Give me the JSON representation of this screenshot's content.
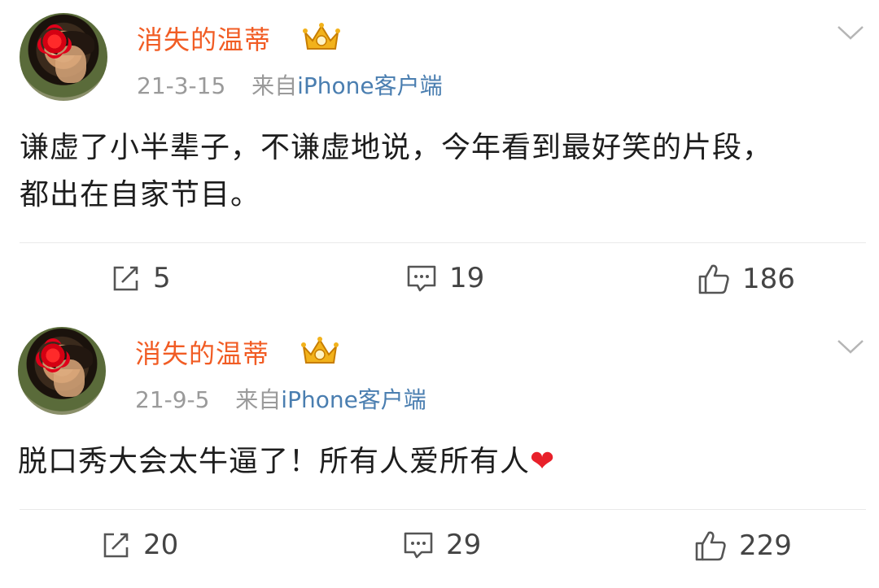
{
  "posts": [
    {
      "username": "消失的温蒂",
      "date": "21-3-15",
      "source_prefix": "来自",
      "source": "iPhone客户端",
      "content_line1": "谦虚了小半辈子，不谦虚地说，今年看到最好笑的片段，",
      "content_line2": "都出在自家节目。",
      "reposts": "5",
      "comments": "19",
      "likes": "186"
    },
    {
      "username": "消失的温蒂",
      "date": "21-9-5",
      "source_prefix": "来自",
      "source": "iPhone客户端",
      "content_line1": "脱口秀大会太牛逼了！所有人爱所有人",
      "emoji": "❤",
      "reposts": "20",
      "comments": "29",
      "likes": "229"
    }
  ],
  "colors": {
    "username": "#f15c24",
    "link": "#4a7eb0",
    "meta": "#9a9a9a",
    "text": "#1d1d1d"
  }
}
